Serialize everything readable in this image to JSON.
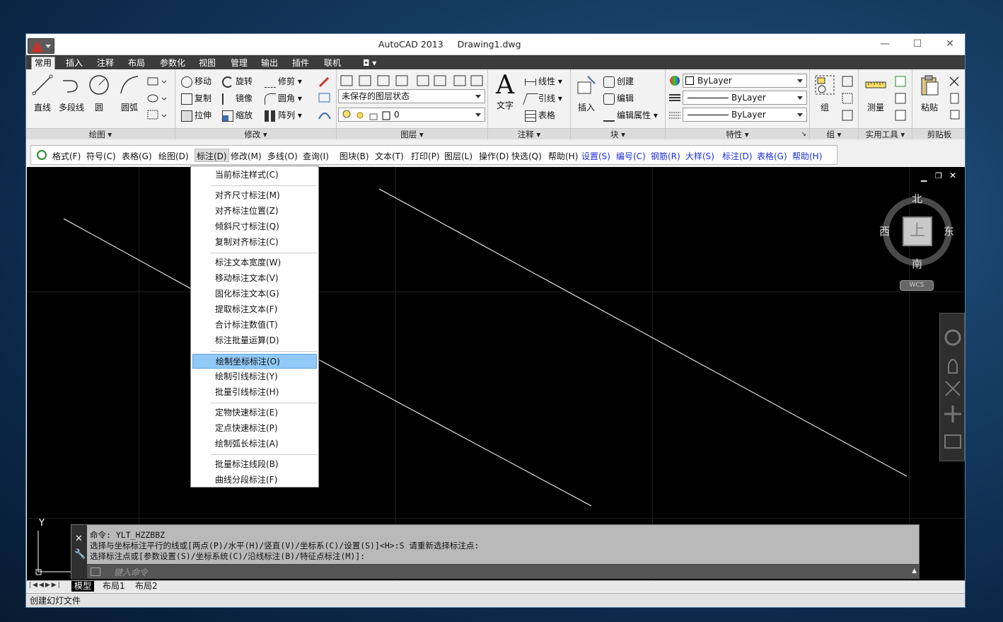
{
  "window": {
    "title": "AutoCAD 2013",
    "filename": "Drawing1.dwg",
    "min": "—",
    "max": "☐",
    "close": "✕"
  },
  "tabs": [
    "常用",
    "插入",
    "注释",
    "布局",
    "参数化",
    "视图",
    "管理",
    "输出",
    "插件",
    "联机",
    "◘ ▾"
  ],
  "ribbon": {
    "draw": {
      "title": "绘图 ▾",
      "line": "直线",
      "polyline": "多段线",
      "circle": "圆",
      "arc": "圆弧"
    },
    "modify": {
      "title": "修改 ▾",
      "move": "移动",
      "rotate": "旋转",
      "trim": "修剪 ▾",
      "copy": "复制",
      "mirror": "镜像",
      "fillet": "圆角 ▾",
      "stretch": "拉伸",
      "scale": "缩放",
      "array": "阵列 ▾"
    },
    "layers": {
      "title": "图层 ▾",
      "state": "未保存的图层状态",
      "layer": "0"
    },
    "annotation": {
      "title": "注释 ▾",
      "text": "文字",
      "linear": "线性 ▾",
      "leader": "引线 ▾",
      "table": "表格"
    },
    "block": {
      "title": "块 ▾",
      "insert": "插入",
      "create": "创建",
      "edit": "编辑",
      "editattr": "编辑属性 ▾"
    },
    "properties": {
      "title": "特性 ▾",
      "color": "ByLayer",
      "linetype": "ByLayer",
      "lineweight": "ByLayer",
      "expand": "↘"
    },
    "groups": {
      "title": "组 ▾",
      "group": "组"
    },
    "utilities": {
      "title": "实用工具 ▾",
      "measure": "测量"
    },
    "clipboard": {
      "title": "剪贴板",
      "paste": "粘贴"
    }
  },
  "menubar": [
    {
      "label": "格式(F)",
      "blue": false
    },
    {
      "label": "符号(C)",
      "blue": false
    },
    {
      "label": "表格(G)",
      "blue": false
    },
    {
      "label": "绘图(D)",
      "blue": false
    },
    {
      "label": "标注(D)",
      "blue": false,
      "active": true
    },
    {
      "label": "修改(M)",
      "blue": false
    },
    {
      "label": "多线(O)",
      "blue": false
    },
    {
      "label": "查询(I)",
      "blue": false
    },
    {
      "label": "图块(B)",
      "blue": false
    },
    {
      "label": "文本(T)",
      "blue": false
    },
    {
      "label": "打印(P)",
      "blue": false
    },
    {
      "label": "图层(L)",
      "blue": false
    },
    {
      "label": "操作(D)",
      "blue": false
    },
    {
      "label": "快选(Q)",
      "blue": false
    },
    {
      "label": "帮助(H)",
      "blue": false
    },
    {
      "label": "设置(S)",
      "blue": true
    },
    {
      "label": "编号(C)",
      "blue": true
    },
    {
      "label": "钢筋(R)",
      "blue": true
    },
    {
      "label": "大样(S)",
      "blue": true
    },
    {
      "label": "标注(D)",
      "blue": true
    },
    {
      "label": "表格(G)",
      "blue": true
    },
    {
      "label": "帮助(H)",
      "blue": true
    }
  ],
  "dropdown": [
    [
      "当前标注样式(C)"
    ],
    [
      "对齐尺寸标注(M)",
      "对齐标注位置(Z)",
      "倾斜尺寸标注(Q)",
      "复制对齐标注(C)"
    ],
    [
      "标注文本宽度(W)",
      "移动标注文本(V)",
      "固化标注文本(G)",
      "提取标注文本(F)",
      "合计标注数值(T)",
      "标注批量运算(D)"
    ],
    [
      "绘制坐标标注(O)",
      "绘制引线标注(Y)",
      "批量引线标注(H)"
    ],
    [
      "定物快速标注(E)",
      "定点快速标注(P)",
      "绘制弧长标注(A)"
    ],
    [
      "批量标注线段(B)",
      "曲线分段标注(F)"
    ]
  ],
  "highlighted": "绘制坐标标注(O)",
  "viewcube": {
    "north": "北",
    "south": "南",
    "east": "东",
    "west": "西",
    "top": "上",
    "wcs": "WCS"
  },
  "ucs": {
    "y": "Y"
  },
  "command": {
    "line1": "命令: YLT_HZZBBZ",
    "line2": "选择与坐标标注平行的线或[两点(P)/水平(H)/竖直(V)/坐标系(C)/设置(S)]<H>:S 请重新选择标注点:",
    "line3": "选择标注点或[参数设置(S)/坐标系统(C)/沿线标注(B)/特征点标注(M)]:",
    "placeholder": "键入命令"
  },
  "layout_tabs": [
    "模型",
    "布局1",
    "布局2"
  ],
  "status": "创建幻灯文件"
}
